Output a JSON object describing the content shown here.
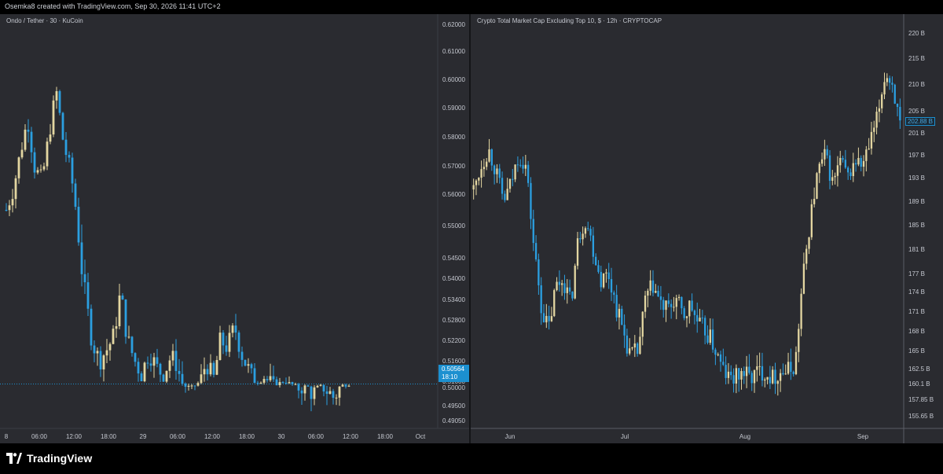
{
  "header": {
    "caption": "Osemka8 created with TradingView.com, Sep 30, 2026 11:41 UTC+2"
  },
  "footer": {
    "brand": "TradingView",
    "icon": "tradingview-logo-icon"
  },
  "colors": {
    "background": "#2a2b30",
    "up": "#e3d6a1",
    "down": "#2b9fe0",
    "badge": "#1c90d0",
    "axis_text": "#c4c7cf"
  },
  "left_chart": {
    "title": "Ondo / Tether · 30 · KuCoin",
    "price_badge": {
      "price": "0.50564",
      "countdown": "18:10"
    },
    "chart_data": {
      "type": "candlestick",
      "y_ticks": [
        "0.62000",
        "0.61000",
        "0.60000",
        "0.59000",
        "0.58000",
        "0.57000",
        "0.56000",
        "0.55000",
        "0.54500",
        "0.54000",
        "0.53400",
        "0.52800",
        "0.52200",
        "0.51600",
        "0.51000",
        "0.50000",
        "0.49500",
        "0.49050"
      ],
      "x_ticks": [
        "8",
        "06:00",
        "12:00",
        "18:00",
        "29",
        "06:00",
        "12:00",
        "18:00",
        "30",
        "06:00",
        "12:00",
        "18:00",
        "Oct"
      ],
      "ylim": [
        0.4895,
        0.6215
      ],
      "last_price": 0.50564,
      "approx_close_path": [
        0.555,
        0.562,
        0.575,
        0.586,
        0.569,
        0.565,
        0.581,
        0.596,
        0.578,
        0.568,
        0.551,
        0.536,
        0.522,
        0.516,
        0.519,
        0.523,
        0.536,
        0.522,
        0.516,
        0.512,
        0.519,
        0.514,
        0.512,
        0.517,
        0.515,
        0.502,
        0.5,
        0.508,
        0.516,
        0.51,
        0.522,
        0.52,
        0.526,
        0.518,
        0.513,
        0.508,
        0.512,
        0.509,
        0.506,
        0.51,
        0.505,
        0.5,
        0.502,
        0.498,
        0.502,
        0.499,
        0.497,
        0.503,
        0.506
      ]
    }
  },
  "right_chart": {
    "title": "Crypto Total Market Cap Excluding Top 10, $ · 12h · CRYPTOCAP",
    "price_badge": "202.88 B",
    "chart_data": {
      "type": "candlestick",
      "y_ticks": [
        "220 B",
        "215 B",
        "210 B",
        "205 B",
        "201 B",
        "197 B",
        "193 B",
        "189 B",
        "185 B",
        "181 B",
        "177 B",
        "174 B",
        "171 B",
        "168 B",
        "165 B",
        "162.5 B",
        "160.1 B",
        "157.85 B",
        "155.65 B"
      ],
      "x_ticks": [
        "Jun",
        "Jul",
        "Aug",
        "Sep"
      ],
      "ylim": [
        154,
        222
      ],
      "last_value": 202.88,
      "approx_close_path": [
        191,
        195,
        198,
        194,
        189,
        192,
        197,
        195,
        182,
        172,
        168,
        175,
        176,
        172,
        183,
        186,
        181,
        176,
        177,
        172,
        168,
        164,
        165,
        173,
        175,
        172,
        171,
        173,
        170,
        172,
        169,
        168,
        166,
        163,
        161,
        161,
        162,
        161,
        162,
        162,
        161,
        162,
        162,
        163,
        176,
        186,
        194,
        197,
        192,
        196,
        193,
        196,
        195,
        199,
        204,
        212,
        210,
        202
      ]
    }
  }
}
